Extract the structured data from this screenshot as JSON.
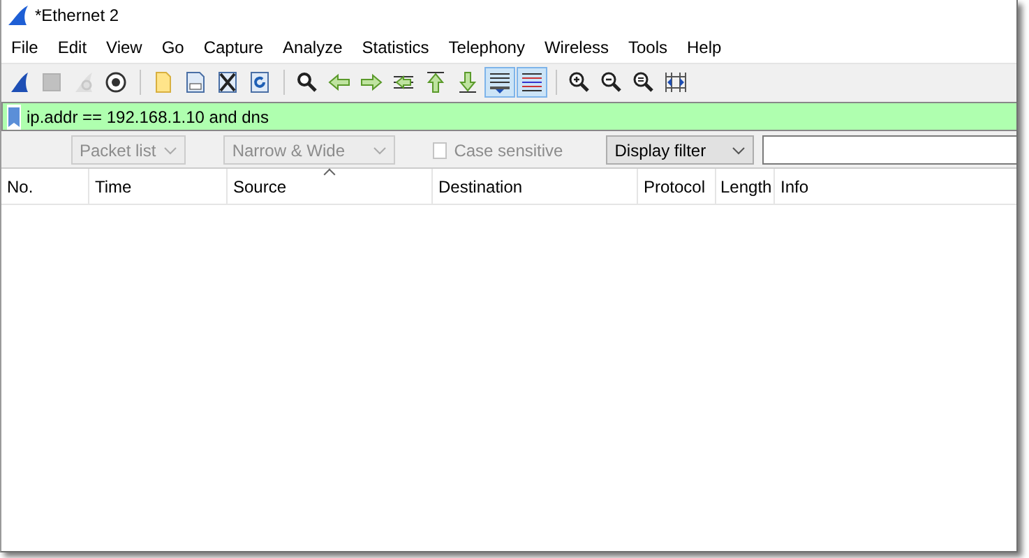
{
  "window": {
    "title": "*Ethernet 2"
  },
  "menu": [
    "File",
    "Edit",
    "View",
    "Go",
    "Capture",
    "Analyze",
    "Statistics",
    "Telephony",
    "Wireless",
    "Tools",
    "Help"
  ],
  "toolbar": [
    {
      "kind": "fin",
      "disabled": false,
      "on": false
    },
    {
      "kind": "stop",
      "disabled": true,
      "on": false
    },
    {
      "kind": "restart",
      "disabled": true,
      "on": false
    },
    {
      "kind": "options",
      "disabled": false,
      "on": false
    },
    {
      "kind": "separator"
    },
    {
      "kind": "open",
      "disabled": false,
      "on": false
    },
    {
      "kind": "save",
      "disabled": false,
      "on": false
    },
    {
      "kind": "close",
      "disabled": false,
      "on": false
    },
    {
      "kind": "reload",
      "disabled": false,
      "on": false
    },
    {
      "kind": "separator"
    },
    {
      "kind": "find",
      "disabled": false,
      "on": false
    },
    {
      "kind": "back",
      "disabled": false,
      "on": false
    },
    {
      "kind": "forward",
      "disabled": false,
      "on": false
    },
    {
      "kind": "goto",
      "disabled": false,
      "on": false
    },
    {
      "kind": "first",
      "disabled": false,
      "on": false
    },
    {
      "kind": "last",
      "disabled": false,
      "on": false
    },
    {
      "kind": "autoscroll",
      "disabled": false,
      "on": true
    },
    {
      "kind": "colorize",
      "disabled": false,
      "on": true
    },
    {
      "kind": "separator"
    },
    {
      "kind": "zoom-in",
      "disabled": false,
      "on": false
    },
    {
      "kind": "zoom-out",
      "disabled": false,
      "on": false
    },
    {
      "kind": "zoom-reset",
      "disabled": false,
      "on": false
    },
    {
      "kind": "resize",
      "disabled": false,
      "on": false
    }
  ],
  "display_filter": {
    "value": "ip.addr == 192.168.1.10 and dns",
    "valid": true
  },
  "find_bar": {
    "search_in": {
      "value": "Packet list",
      "disabled": true
    },
    "char_width": {
      "value": "Narrow & Wide",
      "disabled": true
    },
    "case_sensitive": {
      "label": "Case sensitive",
      "checked": false,
      "disabled": true
    },
    "search_type": {
      "value": "Display filter",
      "disabled": false
    }
  },
  "packet_list": {
    "columns": [
      {
        "label": "No.",
        "sorted": false
      },
      {
        "label": "Time",
        "sorted": false
      },
      {
        "label": "Source",
        "sorted": true
      },
      {
        "label": "Destination",
        "sorted": false
      },
      {
        "label": "Protocol",
        "sorted": false
      },
      {
        "label": "Length",
        "sorted": false
      },
      {
        "label": "Info",
        "sorted": false
      }
    ]
  }
}
